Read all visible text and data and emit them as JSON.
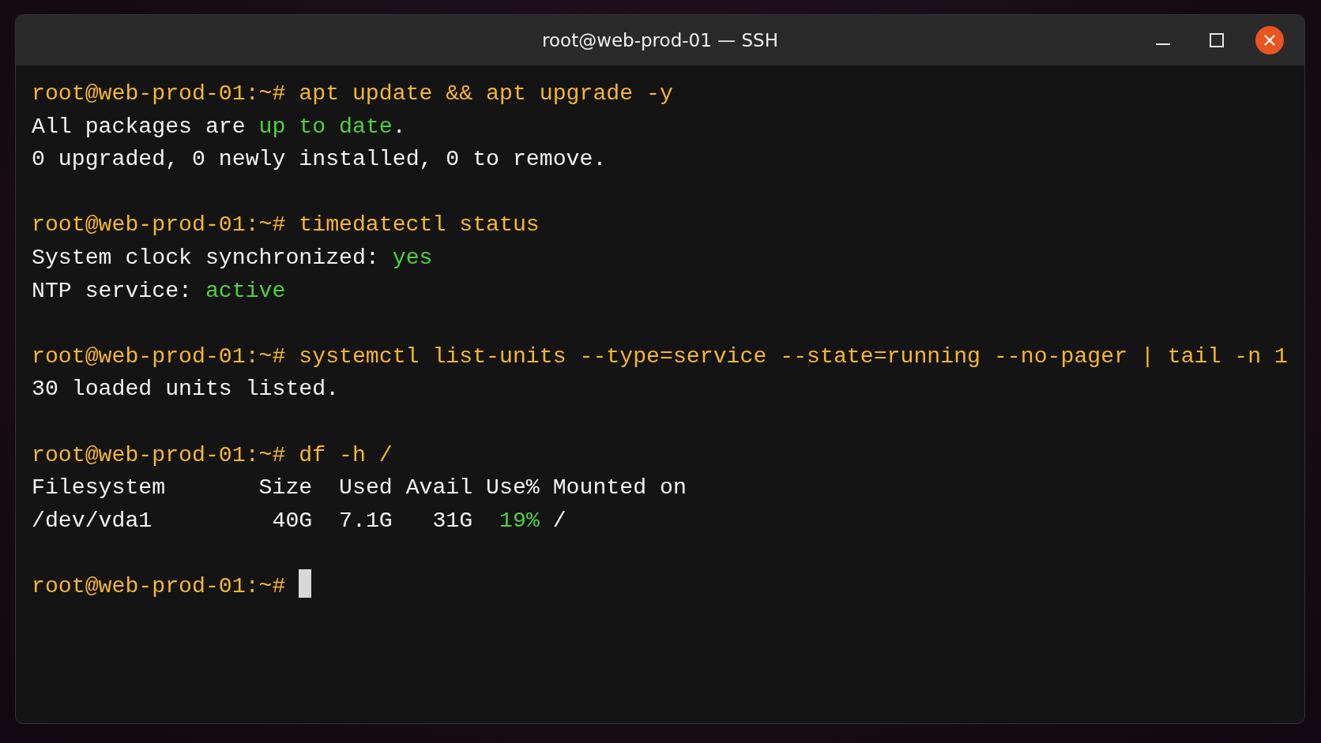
{
  "window": {
    "title": "root@web-prod-01 — SSH"
  },
  "terminal": {
    "cursor": true,
    "blocks": [
      {
        "prompt": "root@web-prod-01:~#",
        "command": "apt update && apt upgrade -y",
        "output": [
          [
            {
              "text": "All packages are ",
              "kind": "plain"
            },
            {
              "text": "up to date",
              "kind": "ok"
            },
            {
              "text": ".",
              "kind": "plain"
            }
          ],
          [
            {
              "text": "0 upgraded, 0 newly installed, 0 to remove.",
              "kind": "plain"
            }
          ]
        ]
      },
      {
        "prompt": "root@web-prod-01:~#",
        "command": "timedatectl status",
        "output": [
          [
            {
              "text": "System clock synchronized: ",
              "kind": "plain"
            },
            {
              "text": "yes",
              "kind": "ok"
            }
          ],
          [
            {
              "text": "NTP service: ",
              "kind": "plain"
            },
            {
              "text": "active",
              "kind": "ok"
            }
          ]
        ]
      },
      {
        "prompt": "root@web-prod-01:~#",
        "command": "systemctl list-units --type=service --state=running --no-pager | tail -n 1",
        "output": [
          [
            {
              "text": "30 loaded units listed.",
              "kind": "plain"
            }
          ]
        ]
      },
      {
        "prompt": "root@web-prod-01:~#",
        "command": "df -h /",
        "output": [
          [
            {
              "text": "Filesystem       Size  Used Avail Use% Mounted on",
              "kind": "plain"
            }
          ],
          [
            {
              "text": "/dev/vda1         40G  7.1G   31G  ",
              "kind": "plain"
            },
            {
              "text": "19%",
              "kind": "ok"
            },
            {
              "text": " /",
              "kind": "plain"
            }
          ]
        ]
      },
      {
        "prompt": "root@web-prod-01:~#"
      }
    ]
  }
}
